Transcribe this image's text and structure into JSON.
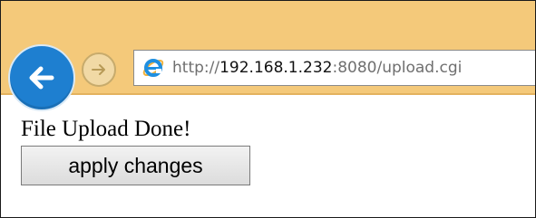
{
  "browser": {
    "back_icon": "back-arrow-icon",
    "forward_icon": "forward-arrow-icon",
    "site_icon": "internet-explorer-icon",
    "url_scheme": "http://",
    "url_host": "192.168.1.232",
    "url_rest": ":8080/upload.cgi",
    "toolbar_color": "#f4c97a",
    "back_button_color": "#1e7fd0"
  },
  "page": {
    "message": "File Upload Done!",
    "apply_button_label": "apply changes"
  }
}
